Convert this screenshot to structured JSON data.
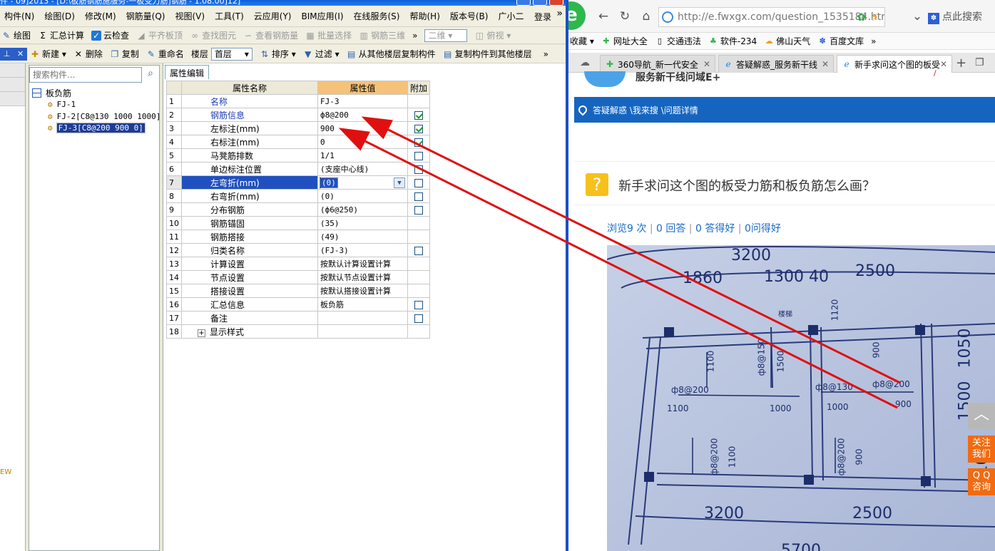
{
  "app": {
    "titlebar_text": "件 - 09]2013 - [D:\\板筋钢筋施服务-一板受力筋]钢筋 - 1.08.00]12]",
    "menu": [
      "构件(N)",
      "绘图(D)",
      "修改(M)",
      "钢筋量(Q)",
      "视图(V)",
      "工具(T)",
      "云应用(Y)",
      "BIM应用(I)",
      "在线服务(S)",
      "帮助(H)",
      "版本号(B)",
      "广小二"
    ],
    "login_label": "登录",
    "toolbar1": {
      "draw": "绘图",
      "sum": "汇总计算",
      "cloud_check": "云检查",
      "flat_slab": "平齐板顶",
      "find_element": "查找图元",
      "view_rebar": "查看钢筋量",
      "batch_select": "批量选择",
      "rebar_3d": "钢筋三维",
      "view_mode": "二维",
      "view_angle": "俯视"
    },
    "toolbar2": {
      "new": "新建",
      "delete": "删除",
      "copy": "复制",
      "rename": "重命名",
      "floor_label": "楼层",
      "floor_value": "首层",
      "sort": "排序",
      "filter": "过滤",
      "copy_from_floor": "从其他楼层复制构件",
      "copy_to_floor": "复制构件到其他楼层"
    },
    "left_strip_text": "EW",
    "tree": {
      "search_placeholder": "搜索构件...",
      "root": "板负筋",
      "items": [
        "FJ-1",
        "FJ-2[C8@130 1000 1000]",
        "FJ-3[C8@200 900 0]"
      ]
    },
    "property": {
      "tab": "属性编辑",
      "headers": [
        "属性名称",
        "属性值",
        "附加"
      ],
      "rows": [
        {
          "n": "1",
          "name": "名称",
          "value": "FJ-3"
        },
        {
          "n": "2",
          "name": "钢筋信息",
          "value": "ф8@200"
        },
        {
          "n": "3",
          "name": "左标注(mm)",
          "value": "900"
        },
        {
          "n": "4",
          "name": "右标注(mm)",
          "value": "0"
        },
        {
          "n": "5",
          "name": "马凳筋排数",
          "value": "1/1"
        },
        {
          "n": "6",
          "name": "单边标注位置",
          "value": "(支座中心线)"
        },
        {
          "n": "7",
          "name": "左弯折(mm)",
          "value": "(0)"
        },
        {
          "n": "8",
          "name": "右弯折(mm)",
          "value": "(0)"
        },
        {
          "n": "9",
          "name": "分布钢筋",
          "value": "(ф6@250)"
        },
        {
          "n": "10",
          "name": "钢筋锚固",
          "value": "(35)"
        },
        {
          "n": "11",
          "name": "钢筋搭接",
          "value": "(49)"
        },
        {
          "n": "12",
          "name": "归类名称",
          "value": "(FJ-3)"
        },
        {
          "n": "13",
          "name": "计算设置",
          "value": "按默认计算设置计算"
        },
        {
          "n": "14",
          "name": "节点设置",
          "value": "按默认节点设置计算"
        },
        {
          "n": "15",
          "name": "搭接设置",
          "value": "按默认搭接设置计算"
        },
        {
          "n": "16",
          "name": "汇总信息",
          "value": "板负筋"
        },
        {
          "n": "17",
          "name": "备注",
          "value": ""
        },
        {
          "n": "18",
          "name": "显示样式",
          "value": ""
        }
      ]
    }
  },
  "browser": {
    "url": "http://e.fwxgx.com/question_1535184.htr",
    "search_label": "点此搜索",
    "favorites": [
      "收藏",
      "网址大全",
      "交通违法",
      "软件-234",
      "佛山天气",
      "百度文库"
    ],
    "tabs": [
      "360导航_新一代安全",
      "答疑解惑_服务新干线",
      "新手求问这个图的板受"
    ],
    "site_name": "服务新干线问域E+",
    "breadcrumb": "答疑解惑 \\我来搜 \\问题详情",
    "question_title": "新手求问这个图的板受力筋和板负筋怎么画？",
    "stats": {
      "views": "浏览9 次",
      "answers": "0 回答",
      "good": "0 答得好",
      "helpful": "0问得好"
    },
    "side": {
      "follow": "关注\n我们",
      "qq": "Q Q\n咨询"
    },
    "drawing_labels": {
      "top1": "3200",
      "top2": "1860",
      "top3": "1300 40",
      "top4": "2500",
      "r1": "1050",
      "r2": "1500",
      "r3": "1050",
      "a1": "1100",
      "a2": "1500",
      "a3": "1120",
      "a4": "900",
      "b1": "ф8@200",
      "b2": "ф8@150",
      "b3": "ф8@130",
      "b4": "ф8@200",
      "b5": "900",
      "c1": "1100",
      "c2": "1000",
      "c3": "1000",
      "d1": "ф8@200",
      "d2": "1100",
      "d3": "ф8@200",
      "d4": "900",
      "bot1": "3200",
      "bot2": "2500",
      "bot3": "5700",
      "stair": "楼梯"
    }
  },
  "colors": {
    "accent_blue": "#1565c0",
    "arrow_red": "#e01010",
    "value_header": "#f5c27a",
    "selected_row": "#2050c0"
  }
}
